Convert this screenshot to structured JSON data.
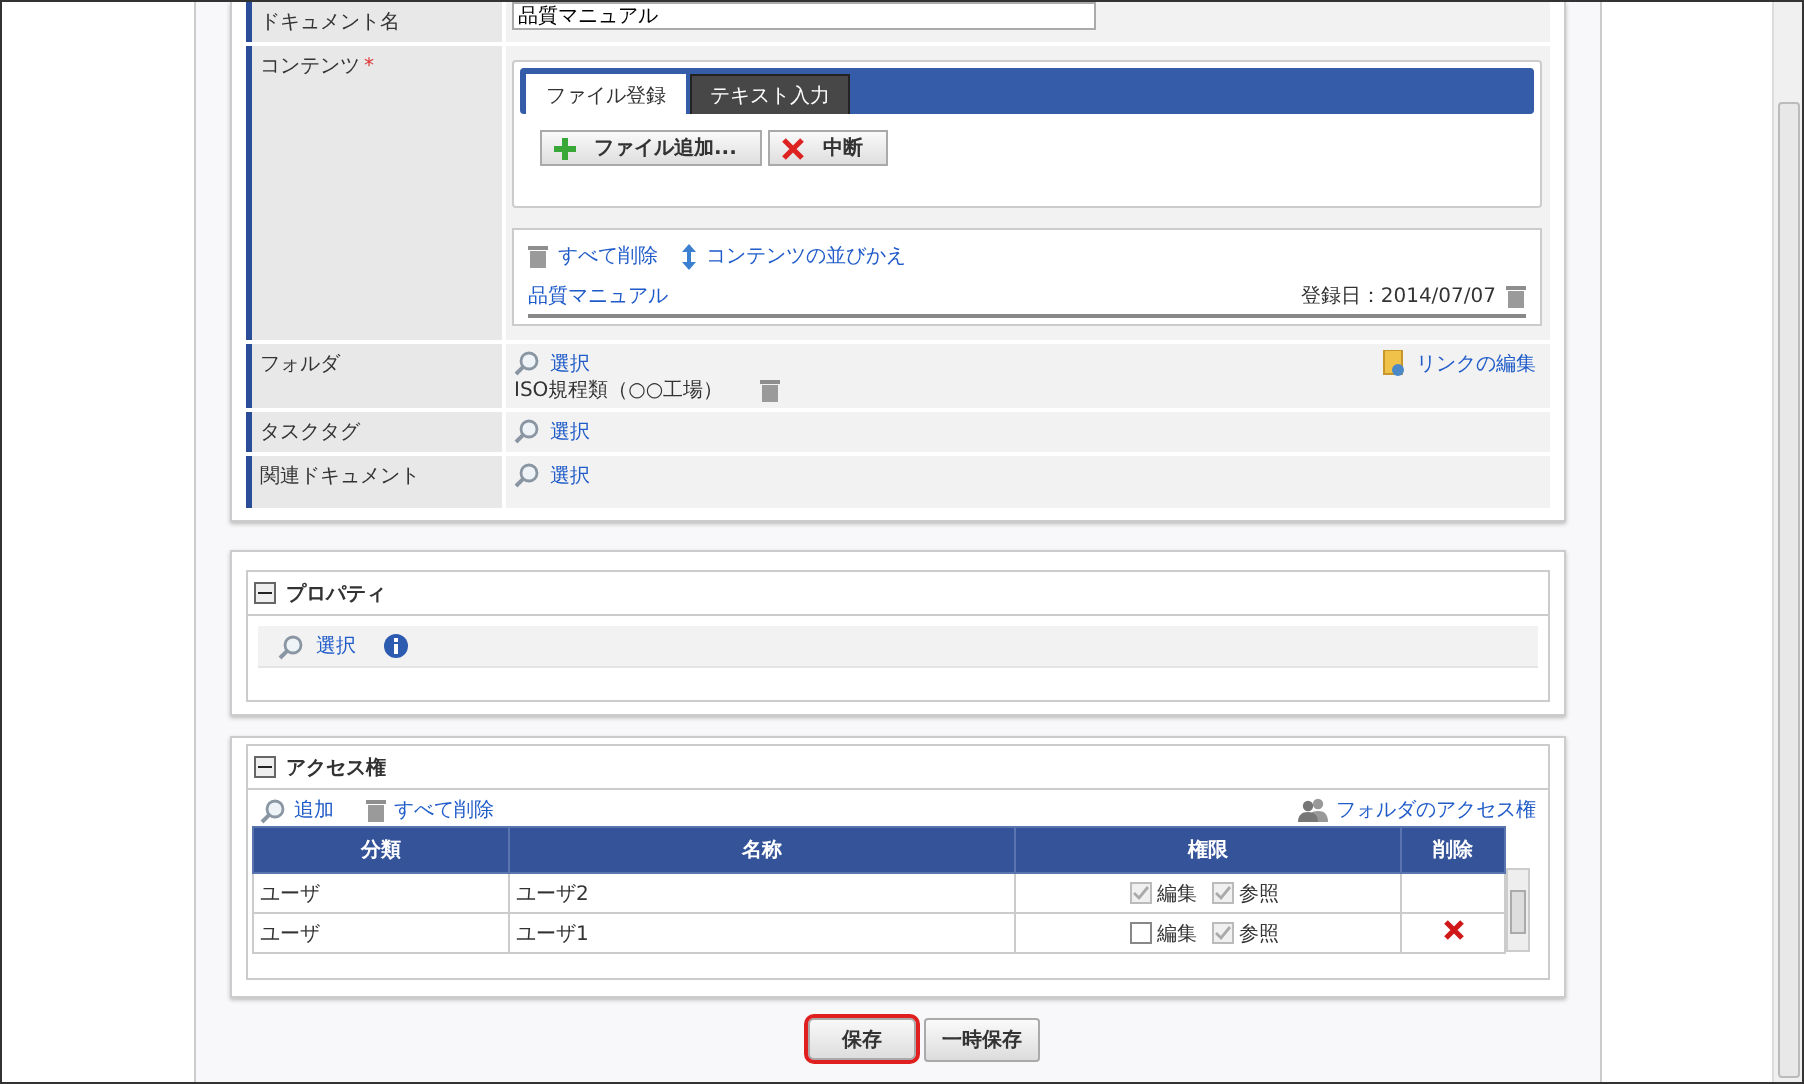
{
  "document_name": {
    "label": "ドキュメント名",
    "value": "品質マニュアル"
  },
  "content": {
    "label": "コンテンツ",
    "required_mark": "*",
    "tabs": [
      {
        "label": "ファイル登録",
        "selected": true
      },
      {
        "label": "テキスト入力",
        "selected": false
      }
    ],
    "buttons": [
      {
        "kind": "add",
        "label": "ファイル追加..."
      },
      {
        "kind": "cancel",
        "label": "中断"
      }
    ],
    "actions": [
      {
        "kind": "delete",
        "label": "すべて削除"
      },
      {
        "kind": "sort",
        "label": "コンテンツの並びかえ"
      }
    ],
    "files": [
      {
        "name": "品質マニュアル",
        "date": "登録日：2014/07/07"
      }
    ]
  },
  "folder": {
    "label": "フォルダ",
    "select": "選択",
    "link": "リンクの編集",
    "items": [
      "ISO規程類（○○工場）"
    ]
  },
  "task_tag": {
    "label": "タスクタグ",
    "select": "選択"
  },
  "related_documents": {
    "label": "関連ドキュメント",
    "select": "選択"
  },
  "properties": {
    "title": "プロパティ",
    "expanded": true,
    "select": "選択"
  },
  "access": {
    "title": "アクセス権",
    "expanded": true,
    "add": "追加",
    "delete_all": "すべて削除",
    "folder_access": "フォルダのアクセス権",
    "columns": [
      "分類",
      "名称",
      "権限",
      "削除"
    ],
    "rows": [
      {
        "type": "ユーザ",
        "name": "ユーザ2",
        "permissions": [
          {
            "label": "編集",
            "checked": true,
            "disabled": true
          },
          {
            "label": "参照",
            "checked": true,
            "disabled": true
          }
        ],
        "deletable": false
      },
      {
        "type": "ユーザ",
        "name": "ユーザ1",
        "permissions": [
          {
            "label": "編集",
            "checked": false,
            "disabled": false
          },
          {
            "label": "参照",
            "checked": true,
            "disabled": true
          }
        ],
        "deletable": true
      }
    ]
  },
  "buttons": [
    {
      "label": "保存",
      "highlighted": true
    },
    {
      "label": "一時保存",
      "highlighted": false
    }
  ]
}
